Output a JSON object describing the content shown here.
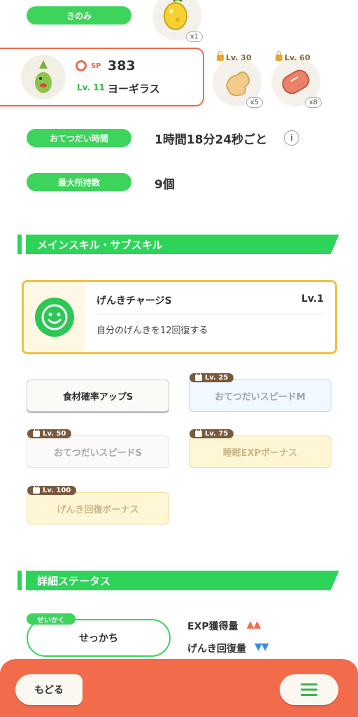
{
  "berry": {
    "label": "きのみ",
    "qty": "x1"
  },
  "pokemon": {
    "sp_label": "SP",
    "sp_value": "383",
    "level": "Lv. 11",
    "name": "ヨーギラス"
  },
  "ingredients": [
    {
      "lock_level": "Lv. 30",
      "qty": "x5",
      "icon": "ginger-icon"
    },
    {
      "lock_level": "Lv. 60",
      "qty": "x8",
      "icon": "sausage-icon"
    }
  ],
  "help_time": {
    "label": "おてつだい時間",
    "value": "1時間18分24秒ごと",
    "info": "i"
  },
  "max_carry": {
    "label": "最大所持数",
    "value": "9個"
  },
  "skills_section": {
    "title": "メインスキル・サブスキル"
  },
  "main_skill": {
    "name": "げんきチャージS",
    "level": "Lv.1",
    "description": "自分のげんきを12回復する"
  },
  "sub_skills": [
    {
      "label": "食材確率アップS",
      "lock": ""
    },
    {
      "label": "おてつだいスピードM",
      "lock": "Lv. 25"
    },
    {
      "label": "おてつだいスピードS",
      "lock": "Lv. 50"
    },
    {
      "label": "睡眠EXPボーナス",
      "lock": "Lv. 75"
    },
    {
      "label": "げんき回復ボーナス",
      "lock": "Lv. 100"
    }
  ],
  "status_section": {
    "title": "詳細ステータス"
  },
  "nature": {
    "tag": "せいかく",
    "value": "せっかち"
  },
  "stats": [
    {
      "label": "EXP獲得量",
      "arrows": "▲▲",
      "color": "#f26b4b"
    },
    {
      "label": "げんき回復量",
      "arrows": "▼▼",
      "color": "#3a8ee8"
    }
  ],
  "footer": {
    "back_label": "もどる"
  }
}
